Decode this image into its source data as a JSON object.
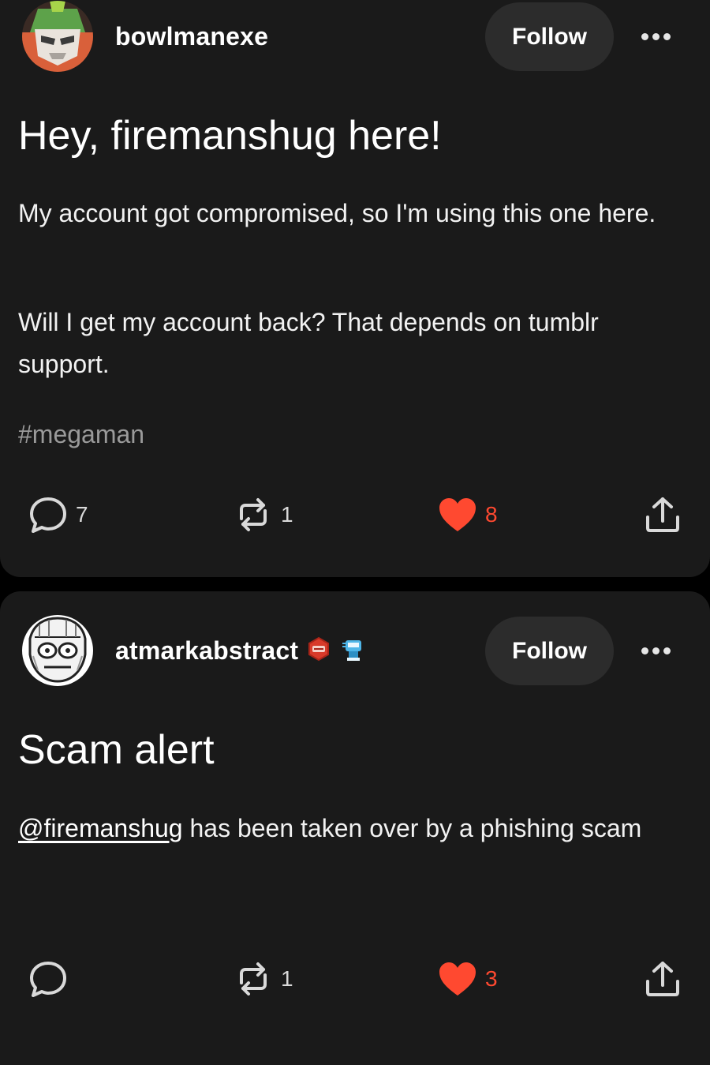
{
  "posts": [
    {
      "username": "bowlmanexe",
      "follow_label": "Follow",
      "title": "Hey, firemanshug here!",
      "paragraphs": [
        "My account got compromised, so I'm using this one here.",
        "Will I get my account back? That depends on tumblr support."
      ],
      "tag": "#megaman",
      "comments": "7",
      "reblogs": "1",
      "likes": "8"
    },
    {
      "username": "atmarkabstract",
      "follow_label": "Follow",
      "title": "Scam alert",
      "mention": "@firemanshug",
      "body_rest": " has been taken over by a phishing scam",
      "reblogs": "1",
      "likes": "3"
    }
  ],
  "icons": {
    "comment": "comment-icon",
    "reblog": "reblog-icon",
    "like": "heart-icon",
    "share": "share-icon",
    "more": "more-dots-icon"
  },
  "colors": {
    "background": "#000000",
    "card": "#1a1a1a",
    "button": "#2c2c2c",
    "like_active": "#ff4930",
    "tag": "#9a9a9a"
  }
}
